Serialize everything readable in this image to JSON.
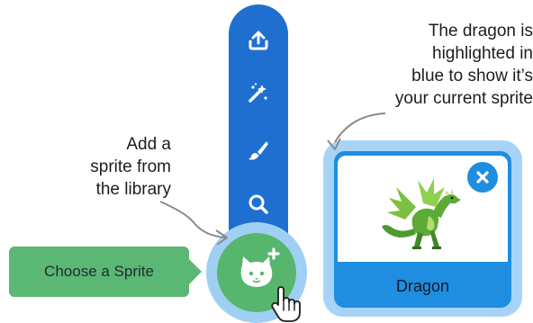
{
  "annotations": {
    "current_sprite": [
      "The dragon is",
      "highlighted in",
      "blue to show it’s",
      "your current sprite"
    ],
    "add_from_library": [
      "Add a",
      "sprite from",
      "the library"
    ]
  },
  "tooltip": {
    "label": "Choose a Sprite"
  },
  "sprite_menu": {
    "items": [
      {
        "icon": "upload-icon"
      },
      {
        "icon": "surprise-icon"
      },
      {
        "icon": "paint-icon"
      },
      {
        "icon": "search-icon"
      }
    ],
    "main_button_icon": "cat-plus-icon"
  },
  "sprite_card": {
    "name": "Dragon",
    "selected": true,
    "delete_icon": "close-icon"
  },
  "colors": {
    "menu_blue": "#1f6fd0",
    "selected_blue": "#1f8ee0",
    "sprite_green": "#57b66e",
    "halo": "#9fd0f4"
  }
}
